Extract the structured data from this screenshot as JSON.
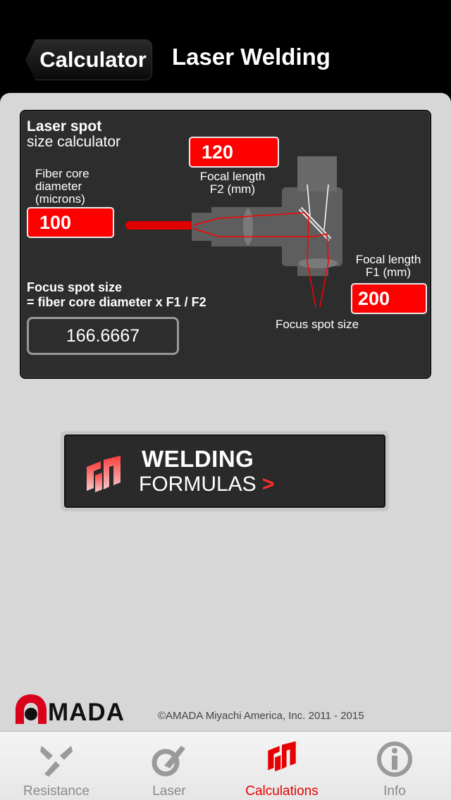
{
  "navbar": {
    "back_label": "Calculator",
    "title": "Laser Welding"
  },
  "calculator": {
    "title_line1": "Laser spot",
    "title_line2": "size calculator",
    "fiber_label": [
      "Fiber core",
      "diameter",
      "(microns)"
    ],
    "fiber_value": "100",
    "f2_label": [
      "Focal length",
      "F2 (mm)"
    ],
    "f2_value": "120",
    "f1_label": [
      "Focal length",
      "F1 (mm)"
    ],
    "f1_value": "200",
    "spot_label": "Focus spot size",
    "formula_line1": "Focus spot size",
    "formula_line2": "= fiber core diameter x F1 / F2",
    "result": "166.6667"
  },
  "welding_button": {
    "line1": "WELDING",
    "line2": "FORMULAS",
    "arrow": ">"
  },
  "footer": {
    "brand": "MADA",
    "copyright": "©AMADA Miyachi America, Inc. 2011 - 2015"
  },
  "tabs": [
    {
      "label": "Resistance",
      "icon": "resistance-icon"
    },
    {
      "label": "Laser",
      "icon": "laser-icon"
    },
    {
      "label": "Calculations",
      "icon": "calculations-icon",
      "active": true
    },
    {
      "label": "Info",
      "icon": "info-icon"
    }
  ],
  "colors": {
    "accent": "#ff0000",
    "active_tab": "#e60000"
  }
}
